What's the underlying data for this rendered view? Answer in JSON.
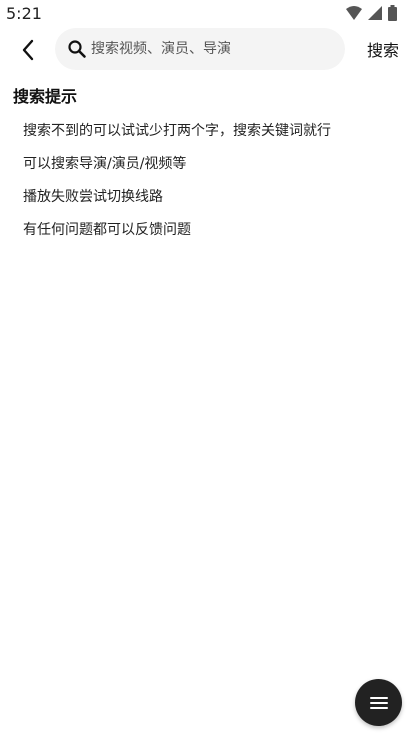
{
  "status_bar": {
    "time": "5:21"
  },
  "header": {
    "back_icon": "chevron-left-icon",
    "search": {
      "placeholder": "搜索视频、演员、导演",
      "value": ""
    },
    "submit_label": "搜索"
  },
  "tips": {
    "title": "搜索提示",
    "items": [
      "搜索不到的可以试试少打两个字，搜索关键词就行",
      "可以搜索导演/演员/视频等",
      "播放失败尝试切换线路",
      "有任何问题都可以反馈问题"
    ]
  },
  "fab": {
    "icon": "menu-icon"
  },
  "colors": {
    "fab_background": "#222222",
    "search_background": "#f4f4f4"
  }
}
